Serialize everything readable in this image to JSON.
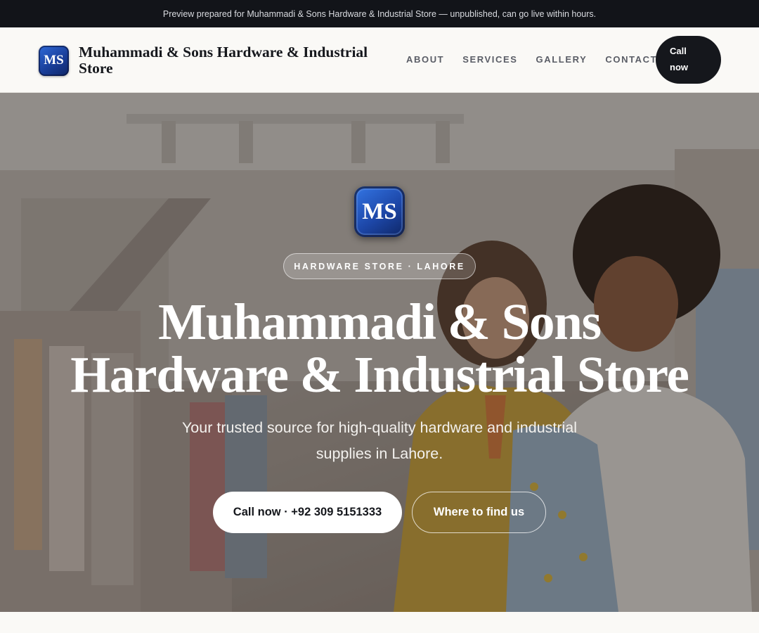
{
  "preview_banner": "Preview prepared for Muhammadi & Sons Hardware & Industrial Store — unpublished, can go live within hours.",
  "brand": {
    "initials": "MS",
    "name": "Muhammadi & Sons Hardware & Industrial Store"
  },
  "nav": {
    "items": [
      "ABOUT",
      "SERVICES",
      "GALLERY",
      "CONTACT"
    ],
    "call_label": "Call now"
  },
  "hero": {
    "badge": "HARDWARE STORE · LAHORE",
    "title": "Muhammadi & Sons Hardware & Industrial Store",
    "subtitle": "Your trusted source for high-quality hardware and industrial supplies in Lahore.",
    "primary_cta": "Call now · +92 309 5151333",
    "secondary_cta": "Where to find us"
  },
  "colors": {
    "dark": "#15171c",
    "topbar": "#121419",
    "page_bg": "#faf9f6",
    "logo_blue": "#1d47a8"
  }
}
